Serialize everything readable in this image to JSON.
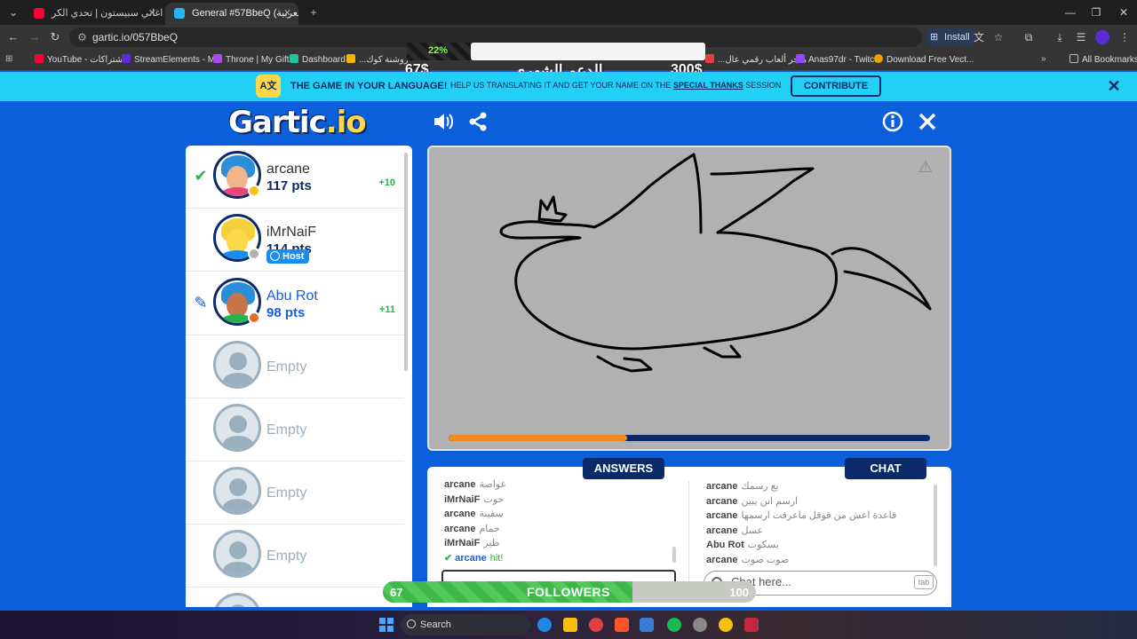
{
  "browser": {
    "tabs": [
      {
        "title": "تحدي اغاني سبيستون | تحدي الكر",
        "favicon_color": "#ff0033"
      },
      {
        "title": "General #57BbeQ (العربية)",
        "favicon_color": "#29b6f6"
      }
    ],
    "url": "gartic.io/057BbeQ",
    "install_label": "Install",
    "bookmarks": [
      {
        "label": "YouTube - الاشتراكات",
        "color": "#ff0033"
      },
      {
        "label": "StreamElements - M...",
        "color": "#5a2bd8"
      },
      {
        "label": "Throne | My Gifts",
        "color": "#a64bf4"
      },
      {
        "label": "Dashboard",
        "color": "#20c4a0"
      },
      {
        "label": "...روشنة كوك",
        "color": "#f4b400"
      },
      {
        "label": "...متجر ألعاب رقمي عال",
        "color": "#e04040"
      },
      {
        "label": "Anas97dr - Twitch",
        "color": "#9146ff"
      },
      {
        "label": "Download Free Vect...",
        "color": "#f29d00"
      }
    ],
    "all_bookmarks_label": "All Bookmarks"
  },
  "overlay": {
    "progress_label": "22%",
    "current_amount": "67$",
    "title": "الدعم الشهري",
    "goal_amount": "300$"
  },
  "banner": {
    "main_text": "THE GAME IN YOUR LANGUAGE!",
    "sub_text_before": "HELP US TRANSLATING IT AND GET YOUR NAME ON THE",
    "sub_text_link": "SPECIAL THANKS",
    "sub_text_after": "SESSION",
    "contribute_label": "CONTRIBUTE"
  },
  "game": {
    "logo_main": "Gartic",
    "logo_suffix": ".io"
  },
  "players": [
    {
      "name": "arcane",
      "points": "117 pts",
      "bonus": "+10",
      "mark": "check",
      "hair": "#2a8fd8",
      "skin": "#f2b48a",
      "shirt": "#e8457a",
      "status": "#f4c20d"
    },
    {
      "name": "iMrNaiF",
      "points": "114 pts",
      "bonus": "",
      "mark": "",
      "host_label": "Host",
      "hair": "#f4d03a",
      "skin": "#ffd84a",
      "shirt": "#1a8cf0",
      "status": "#b0b0b0"
    },
    {
      "name": "Abu Rot",
      "points": "98 pts",
      "bonus": "+11",
      "mark": "pencil",
      "hair": "#2a8fd8",
      "skin": "#c8744a",
      "shirt": "#29b34a",
      "status": "#e07020"
    },
    {
      "name": "Empty"
    },
    {
      "name": "Empty"
    },
    {
      "name": "Empty"
    },
    {
      "name": "Empty"
    }
  ],
  "timer_progress": 0.37,
  "answers": {
    "title": "ANSWERS",
    "messages": [
      {
        "author": "arcane",
        "text": "غواصة"
      },
      {
        "author": "iMrNaiF",
        "text": "حوت"
      },
      {
        "author": "arcane",
        "text": "سفينة"
      },
      {
        "author": "arcane",
        "text": "حمام"
      },
      {
        "author": "iMrNaiF",
        "text": "طير"
      },
      {
        "author": "arcane",
        "text": "hit!",
        "hit": true
      }
    ]
  },
  "chat": {
    "title": "CHAT",
    "placeholder": "Chat here...",
    "tab_hint": "tab",
    "messages": [
      {
        "author": "arcane",
        "text": "يع رسمك"
      },
      {
        "author": "arcane",
        "text": "ارسم انن يبين"
      },
      {
        "author": "arcane",
        "text": "قاعدة اعش من قوقل ماعرفت ارسمها"
      },
      {
        "author": "arcane",
        "text": "عسل"
      },
      {
        "author": "Abu Rot",
        "text": "بسكوت"
      },
      {
        "author": "arcane",
        "text": "صوت صوت"
      }
    ]
  },
  "followers": {
    "current": "67",
    "label": "FOLLOWERS",
    "goal": "100",
    "progress": 0.67
  },
  "taskbar": {
    "search_placeholder": "Search"
  }
}
